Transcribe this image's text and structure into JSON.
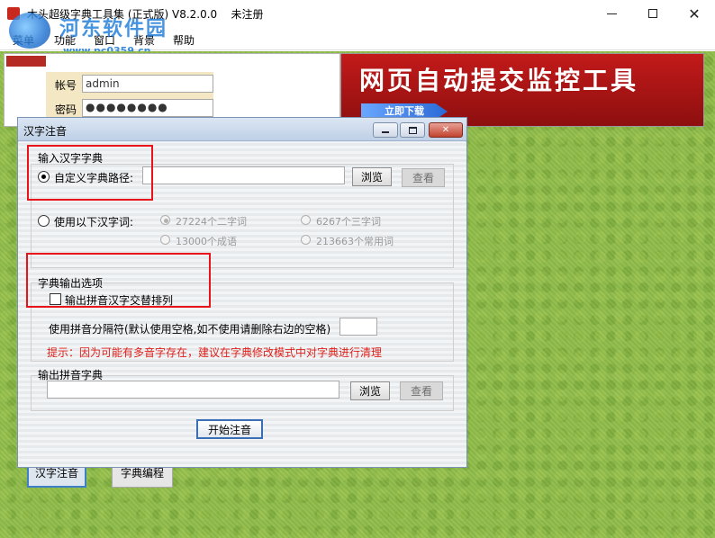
{
  "window": {
    "title": "木头超级字典工具集 (正式版) V8.2.0.0",
    "status": "未注册",
    "controls": {
      "minimize": "minimize-icon",
      "maximize": "maximize-icon",
      "close": "✕"
    }
  },
  "watermark": {
    "title": "河东软件园",
    "url": "www.pc0359.cn"
  },
  "menu": {
    "items": [
      "菜单",
      "功能",
      "窗口",
      "背景",
      "帮助"
    ]
  },
  "login": {
    "username_label": "帐号",
    "username_value": "admin",
    "password_label": "密码",
    "password_value": "●●●●●●●●"
  },
  "banner": {
    "text": "网页自动提交监控工具",
    "button": "立即下载",
    "color": "#c31a1a"
  },
  "background_buttons": [
    "汉字注音",
    "字典编程"
  ],
  "dialog": {
    "title": "汉字注音",
    "controls": {
      "minimize": "minimize-icon",
      "maximize": "maximize-icon",
      "close": "✕"
    },
    "input_group": {
      "label": "输入汉字字典",
      "custom_path_label": "自定义字典路径:",
      "custom_path_value": "",
      "browse": "浏览",
      "view": "查看",
      "use_following_label": "使用以下汉字词:",
      "options": [
        "27224个二字词",
        "6267个三字词",
        "13000个成语",
        "213663个常用词"
      ]
    },
    "output_options": {
      "label": "字典输出选项",
      "alternate_checkbox": "输出拼音汉字交替排列",
      "separator_label": "使用拼音分隔符(默认使用空格,如不使用请删除右边的空格)",
      "separator_value": "",
      "hint": "提示：因为可能有多音字存在，建议在字典修改模式中对字典进行清理"
    },
    "output_dict": {
      "label": "输出拼音字典",
      "path_value": "",
      "browse": "浏览",
      "view": "查看"
    },
    "start_button": "开始注音"
  },
  "colors": {
    "highlight": "#e8141a",
    "hint": "#e0201a",
    "grass": "#8fbc4a"
  }
}
